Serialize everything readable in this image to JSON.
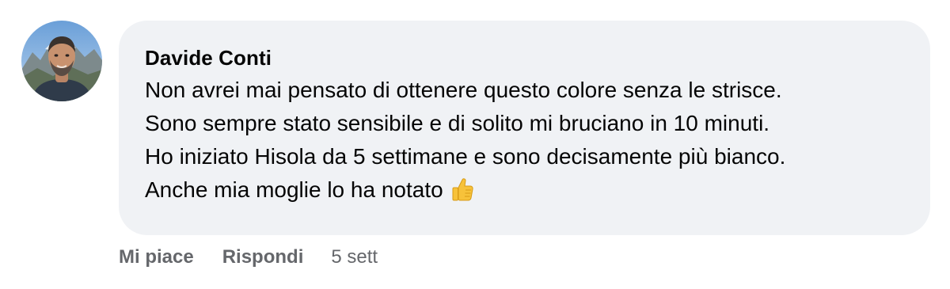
{
  "comment": {
    "author": "Davide Conti",
    "lines": [
      "Non avrei mai pensato di ottenere questo colore senza le strisce.",
      "Sono sempre stato sensibile e di solito mi bruciano in 10 minuti.",
      "Ho iniziato Hisola da 5 settimane e sono decisamente più bianco.",
      "Anche mia moglie lo ha notato"
    ],
    "trailing_emoji": "thumbs-up-icon"
  },
  "actions": {
    "like_label": "Mi piace",
    "reply_label": "Rispondi",
    "timestamp": "5 sett"
  },
  "colors": {
    "bubble_background": "#f0f2f5",
    "text": "#050505",
    "secondary_text": "#65676b"
  }
}
